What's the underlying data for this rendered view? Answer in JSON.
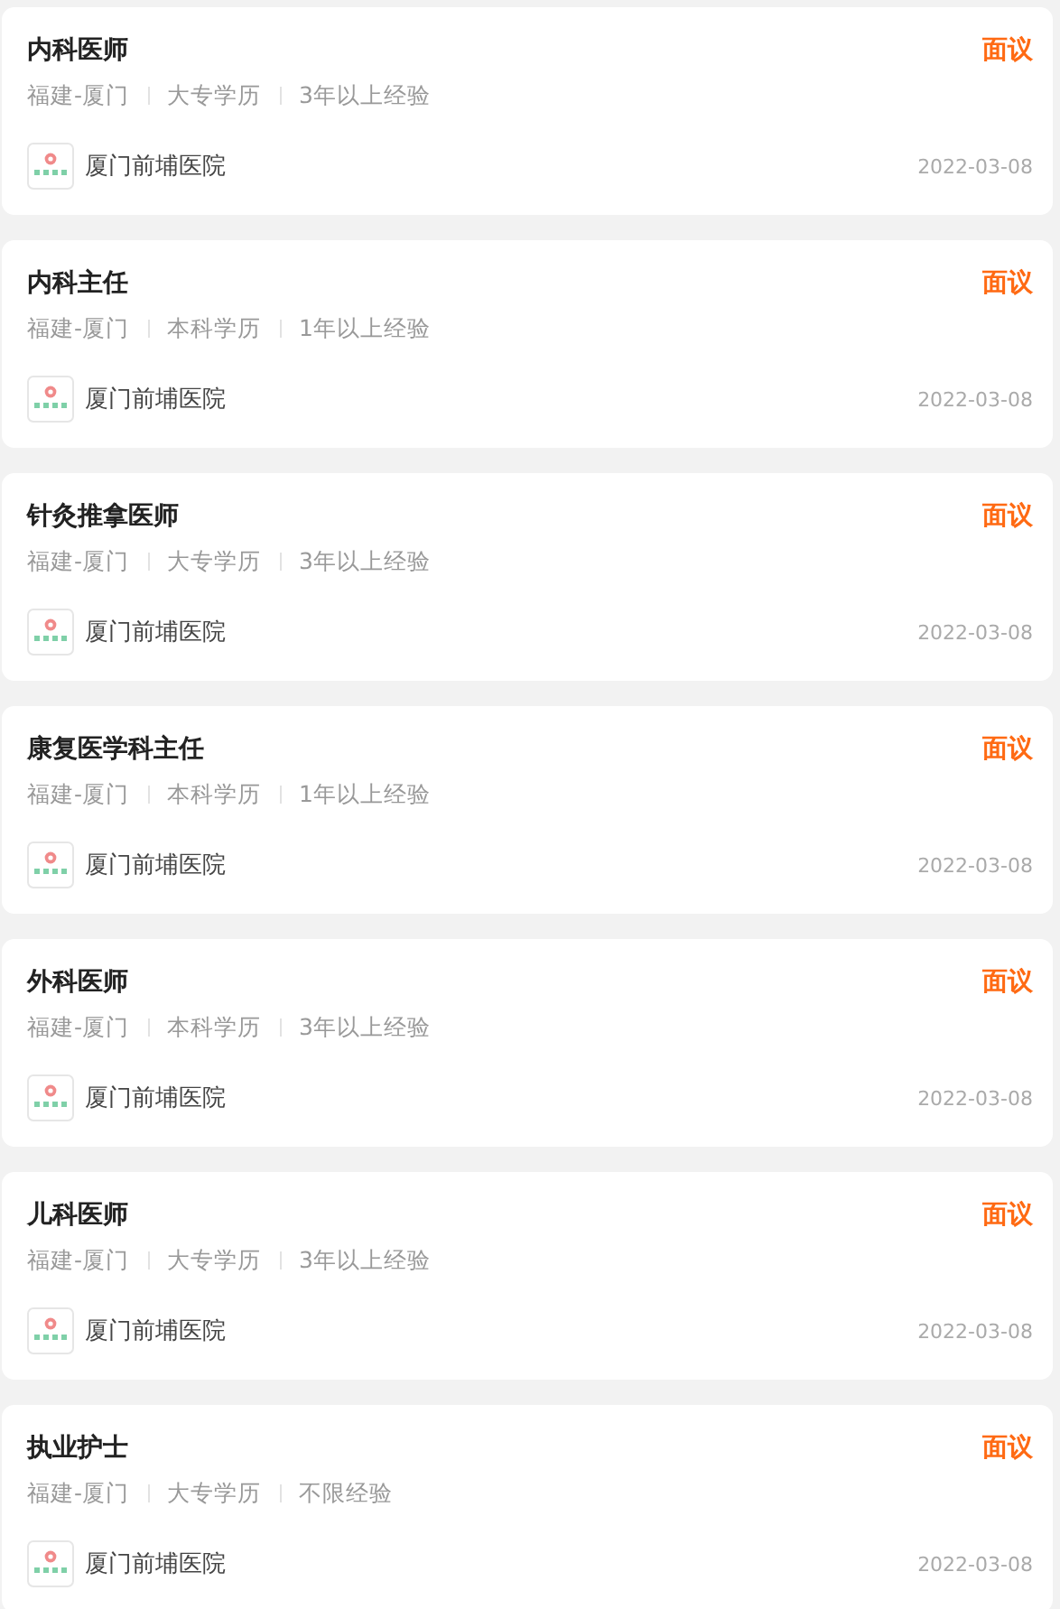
{
  "jobs": [
    {
      "title": "内科医师",
      "salary": "面议",
      "tags": [
        "福建-厦门",
        "大专学历",
        "3年以上经验"
      ],
      "company": "厦门前埔医院",
      "date": "2022-03-08"
    },
    {
      "title": "内科主任",
      "salary": "面议",
      "tags": [
        "福建-厦门",
        "本科学历",
        "1年以上经验"
      ],
      "company": "厦门前埔医院",
      "date": "2022-03-08"
    },
    {
      "title": "针灸推拿医师",
      "salary": "面议",
      "tags": [
        "福建-厦门",
        "大专学历",
        "3年以上经验"
      ],
      "company": "厦门前埔医院",
      "date": "2022-03-08"
    },
    {
      "title": "康复医学科主任",
      "salary": "面议",
      "tags": [
        "福建-厦门",
        "本科学历",
        "1年以上经验"
      ],
      "company": "厦门前埔医院",
      "date": "2022-03-08"
    },
    {
      "title": "外科医师",
      "salary": "面议",
      "tags": [
        "福建-厦门",
        "本科学历",
        "3年以上经验"
      ],
      "company": "厦门前埔医院",
      "date": "2022-03-08"
    },
    {
      "title": "儿科医师",
      "salary": "面议",
      "tags": [
        "福建-厦门",
        "大专学历",
        "3年以上经验"
      ],
      "company": "厦门前埔医院",
      "date": "2022-03-08"
    },
    {
      "title": "执业护士",
      "salary": "面议",
      "tags": [
        "福建-厦门",
        "大专学历",
        "不限经验"
      ],
      "company": "厦门前埔医院",
      "date": "2022-03-08"
    }
  ]
}
